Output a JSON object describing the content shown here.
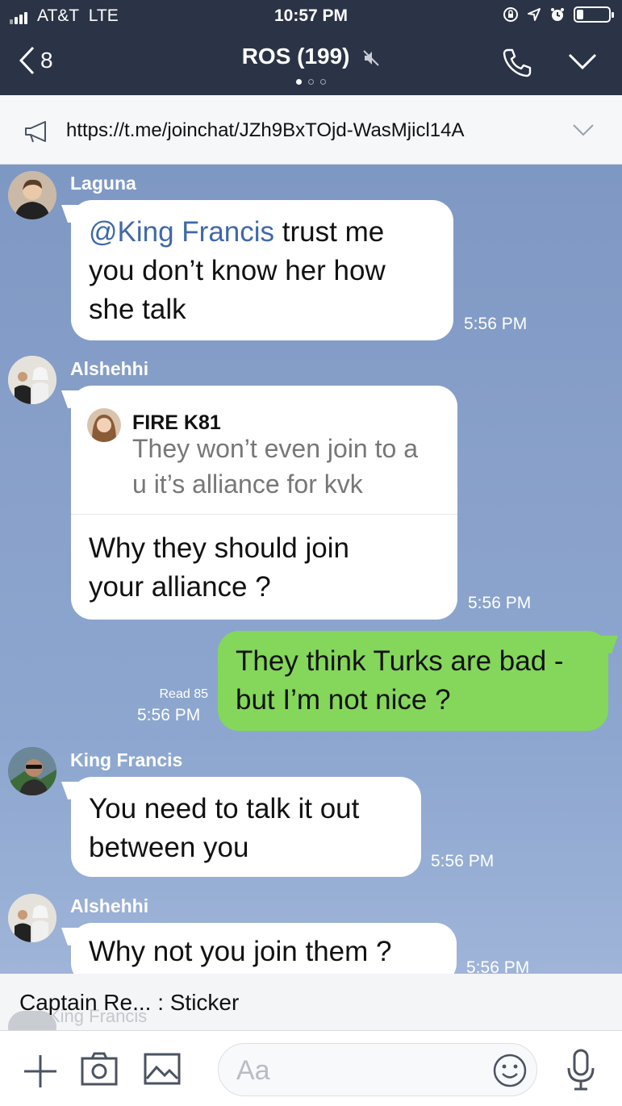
{
  "status_bar": {
    "carrier": "AT&T",
    "network": "LTE",
    "time": "10:57 PM",
    "signal_bars": 4,
    "battery_level": 0.2
  },
  "header": {
    "back_count": "8",
    "title": "ROS (199)",
    "muted": true,
    "page_dots": 3,
    "active_page": 1
  },
  "pinned": {
    "icon": "megaphone-icon",
    "link": "https://t.me/joinchat/JZh9BxTOjd-WasMjicl14A"
  },
  "messages": [
    {
      "sender": "Laguna",
      "mention": "@King Francis",
      "text": " trust me you don’t know her how she talk",
      "time": "5:56 PM"
    },
    {
      "sender": "Alshehhi",
      "reply_to": {
        "name": "FIRE  K81",
        "text": "They won’t even join to a u it’s alliance for kvk"
      },
      "text": "Why they should join your alliance ?",
      "time": "5:56 PM"
    },
    {
      "outgoing": true,
      "read": "Read 85",
      "text": "They think Turks are bad - but I’m not nice ?",
      "time": "5:56 PM"
    },
    {
      "sender": "King Francis",
      "text": "You need to talk it out between you",
      "time": "5:56 PM"
    },
    {
      "sender": "Alshehhi",
      "text": "Why not you join them ?",
      "time": "5:56 PM"
    }
  ],
  "preview": {
    "text": "Captain Re... : Sticker",
    "ghost": "King Francis"
  },
  "composer": {
    "placeholder": "Aa"
  },
  "colors": {
    "header_bg": "#2b3446",
    "chat_bg": "#7f9ac6",
    "outgoing_bubble": "#84d75a",
    "mention": "#3f69a8"
  }
}
